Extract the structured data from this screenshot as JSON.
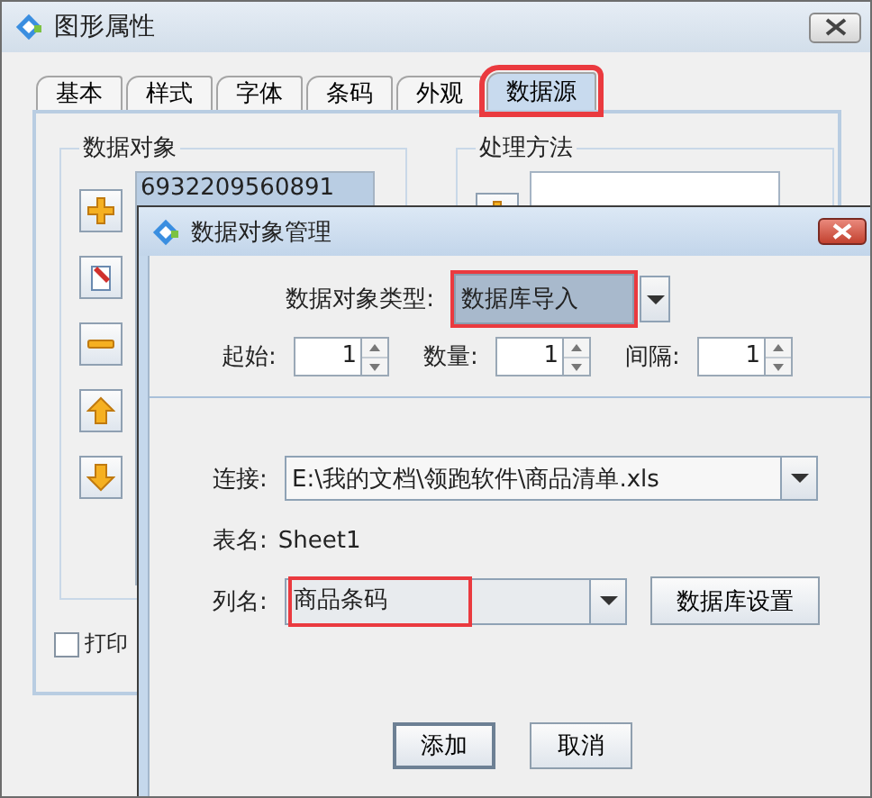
{
  "main_window": {
    "title": "图形属性",
    "tabs": [
      {
        "label": "基本",
        "selected": false,
        "highlighted": false
      },
      {
        "label": "样式",
        "selected": false,
        "highlighted": false
      },
      {
        "label": "字体",
        "selected": false,
        "highlighted": false
      },
      {
        "label": "条码",
        "selected": false,
        "highlighted": false
      },
      {
        "label": "外观",
        "selected": false,
        "highlighted": false
      },
      {
        "label": "数据源",
        "selected": true,
        "highlighted": true
      }
    ],
    "data_objects": {
      "title": "数据对象",
      "items": [
        {
          "text": "6932209560891",
          "selected": true
        }
      ]
    },
    "processing": {
      "title": "处理方法"
    },
    "print_checkbox": {
      "label": "打印",
      "checked": false
    }
  },
  "dialog": {
    "title": "数据对象管理",
    "type": {
      "label": "数据对象类型:",
      "value": "数据库导入",
      "highlighted": true
    },
    "spinners": [
      {
        "label": "起始:",
        "value": "1"
      },
      {
        "label": "数量:",
        "value": "1"
      },
      {
        "label": "间隔:",
        "value": "1"
      }
    ],
    "connection": {
      "label": "连接:",
      "value": "E:\\我的文档\\领跑软件\\商品清单.xls"
    },
    "table_name": {
      "label": "表名:",
      "value": "Sheet1"
    },
    "column": {
      "label": "列名:",
      "value": "商品条码",
      "highlighted": true
    },
    "settings_button": "数据库设置",
    "buttons": [
      {
        "label": "添加",
        "default": true
      },
      {
        "label": "取消",
        "default": false
      }
    ]
  }
}
